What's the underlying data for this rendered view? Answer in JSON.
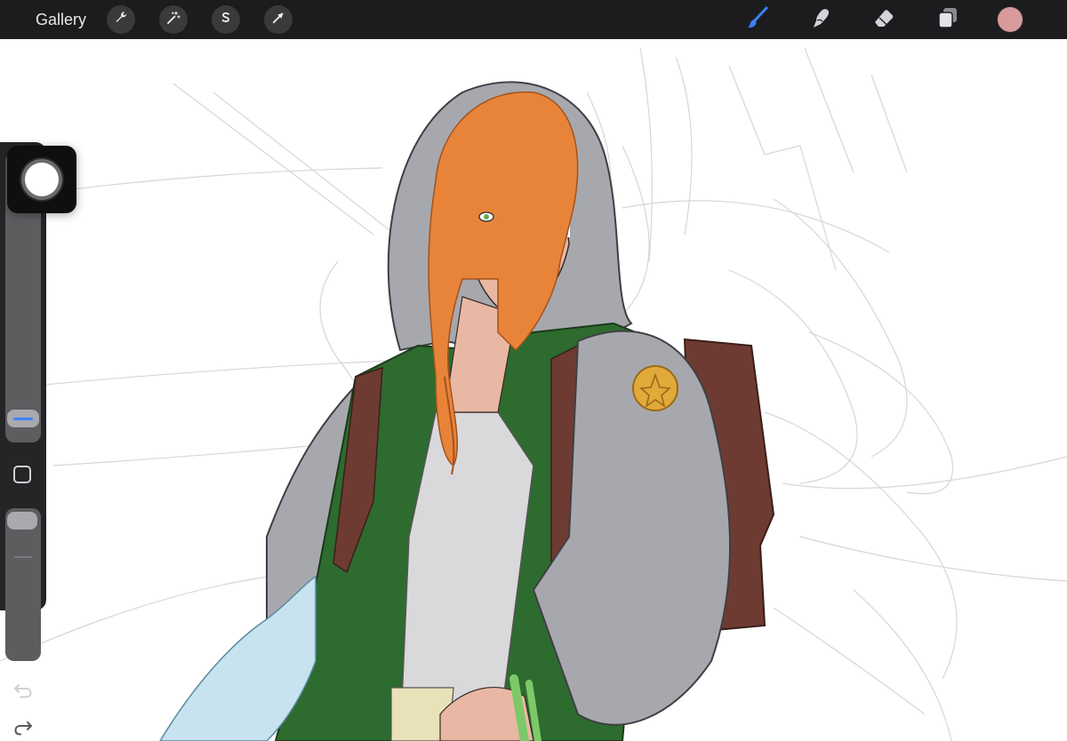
{
  "topbar": {
    "gallery_label": "Gallery",
    "actions": [
      {
        "name": "actions-icon",
        "kind": "wrench"
      },
      {
        "name": "adjustments-icon",
        "kind": "magic-wand"
      },
      {
        "name": "selection-icon",
        "kind": "s-curve"
      },
      {
        "name": "transform-icon",
        "kind": "arrow"
      }
    ],
    "tools": [
      {
        "name": "brush-icon",
        "active": true
      },
      {
        "name": "smudge-icon",
        "active": false
      },
      {
        "name": "eraser-icon",
        "active": false
      },
      {
        "name": "layers-icon",
        "active": false
      }
    ],
    "current_color": "#d99a9b"
  },
  "sidebar": {
    "brush_size_level": 0.05,
    "brush_opacity_level": 1.0
  },
  "colors": {
    "accent": "#3b82f6",
    "bar_bg": "#1c1c1e",
    "sidebar_bg": "#252527",
    "hair": "#e8843a",
    "hood": "#a7a8ad",
    "jacket": "#2d6b2e",
    "bag": "#6e3b32",
    "skin": "#e8b8a4",
    "badge": "#e2a93b",
    "cloth": "#c7e3ef"
  }
}
